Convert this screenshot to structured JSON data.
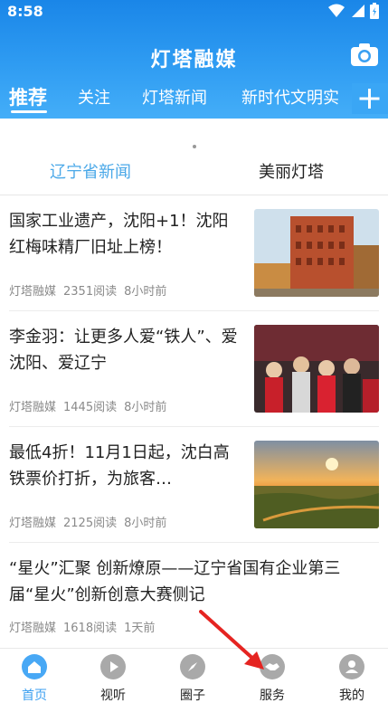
{
  "status": {
    "time": "8:58"
  },
  "header": {
    "title": "灯塔融媒"
  },
  "tabs": [
    "推荐",
    "关注",
    "灯塔新闻",
    "新时代文明实"
  ],
  "categories": [
    "辽宁省新闻",
    "美丽灯塔"
  ],
  "news": [
    {
      "title": "国家工业遗产，沈阳+1！沈阳红梅味精厂旧址上榜！",
      "source": "灯塔融媒",
      "reads": "2351阅读",
      "time": "8小时前"
    },
    {
      "title": "李金羽：让更多人爱“铁人”、爱沈阳、爱辽宁",
      "source": "灯塔融媒",
      "reads": "1445阅读",
      "time": "8小时前"
    },
    {
      "title": "最低4折！11月1日起，沈白高铁票价打折，为旅客…",
      "source": "灯塔融媒",
      "reads": "2125阅读",
      "time": "8小时前"
    },
    {
      "title": "“星火”汇聚 创新燎原——辽宁省国有企业第三届“星火”创新创意大赛侧记",
      "source": "灯塔融媒",
      "reads": "1618阅读",
      "time": "1天前"
    }
  ],
  "bottom_nav": [
    "首页",
    "视听",
    "圈子",
    "服务",
    "我的"
  ],
  "colors": {
    "header": "#2f9cf2",
    "accent": "#4aa8e8",
    "nav_active": "#3b9ff0"
  }
}
